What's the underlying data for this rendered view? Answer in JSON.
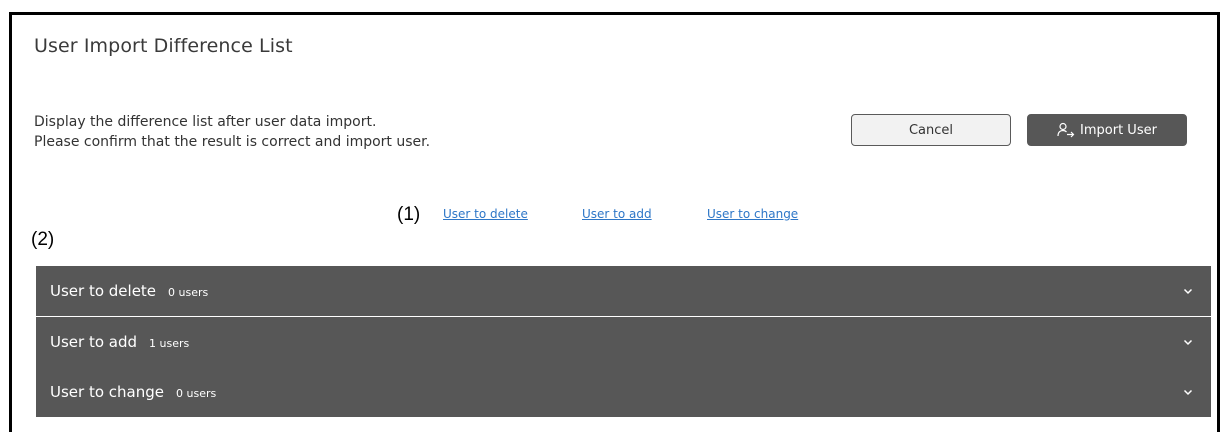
{
  "page": {
    "title": "User Import Difference List"
  },
  "description": {
    "line1": "Display the difference list after user data import.",
    "line2": "Please confirm that the result is correct and import user."
  },
  "buttons": {
    "cancel": "Cancel",
    "import": "Import User",
    "import_icon": "user-import-icon"
  },
  "annotations": {
    "a1": "(1)",
    "a2": "(2)"
  },
  "links": {
    "delete": "User to delete",
    "add": "User to add",
    "change": "User to change"
  },
  "sections": [
    {
      "title": "User to delete",
      "count": "0 users"
    },
    {
      "title": "User to add",
      "count": "1 users"
    },
    {
      "title": "User to change",
      "count": "0 users"
    }
  ],
  "colors": {
    "header_bg": "#575757",
    "link": "#2d76c7",
    "button_dark": "#575757"
  }
}
